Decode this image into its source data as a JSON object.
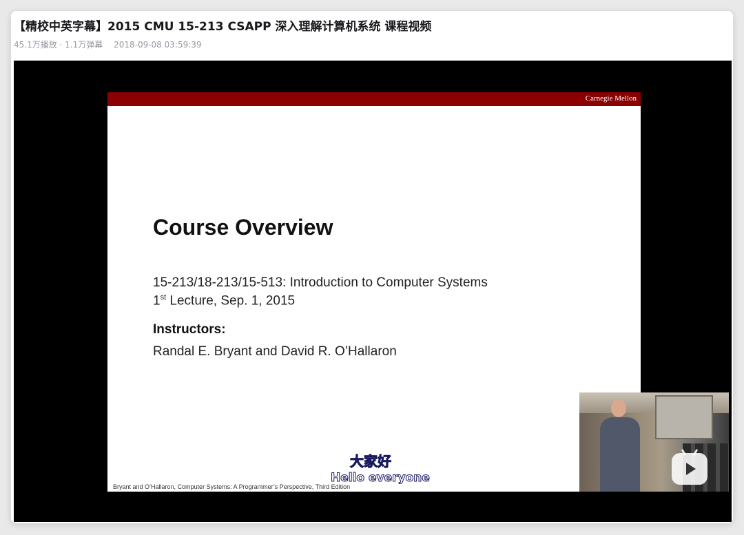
{
  "video": {
    "title": "【精校中英字幕】2015 CMU 15-213 CSAPP 深入理解计算机系统 课程视频",
    "views": "45.1万播放 · 1.1万弹幕",
    "date": "2018-09-08 03:59:39"
  },
  "slide": {
    "brand": "Carnegie Mellon",
    "heading": "Course Overview",
    "course_line": "15-213/18-213/15-513: Introduction to Computer Systems",
    "lecture_num": "1",
    "lecture_sup": "st",
    "lecture_rest": " Lecture, Sep. 1, 2015",
    "instructors_label": "Instructors:",
    "instructors": "Randal E. Bryant and David R. O’Hallaron",
    "footer": "Bryant and O’Hallaron, Computer Systems: A Programmer’s Perspective, Third Edition"
  },
  "subtitles": {
    "chinese": "大家好",
    "english": "Hello everyone"
  },
  "pip": {
    "icon": "bilibili-tv-play-icon"
  },
  "colors": {
    "brand_bar": "#8b0000",
    "subtitle_cn": "#f6e94a",
    "player_bg": "#000000"
  }
}
